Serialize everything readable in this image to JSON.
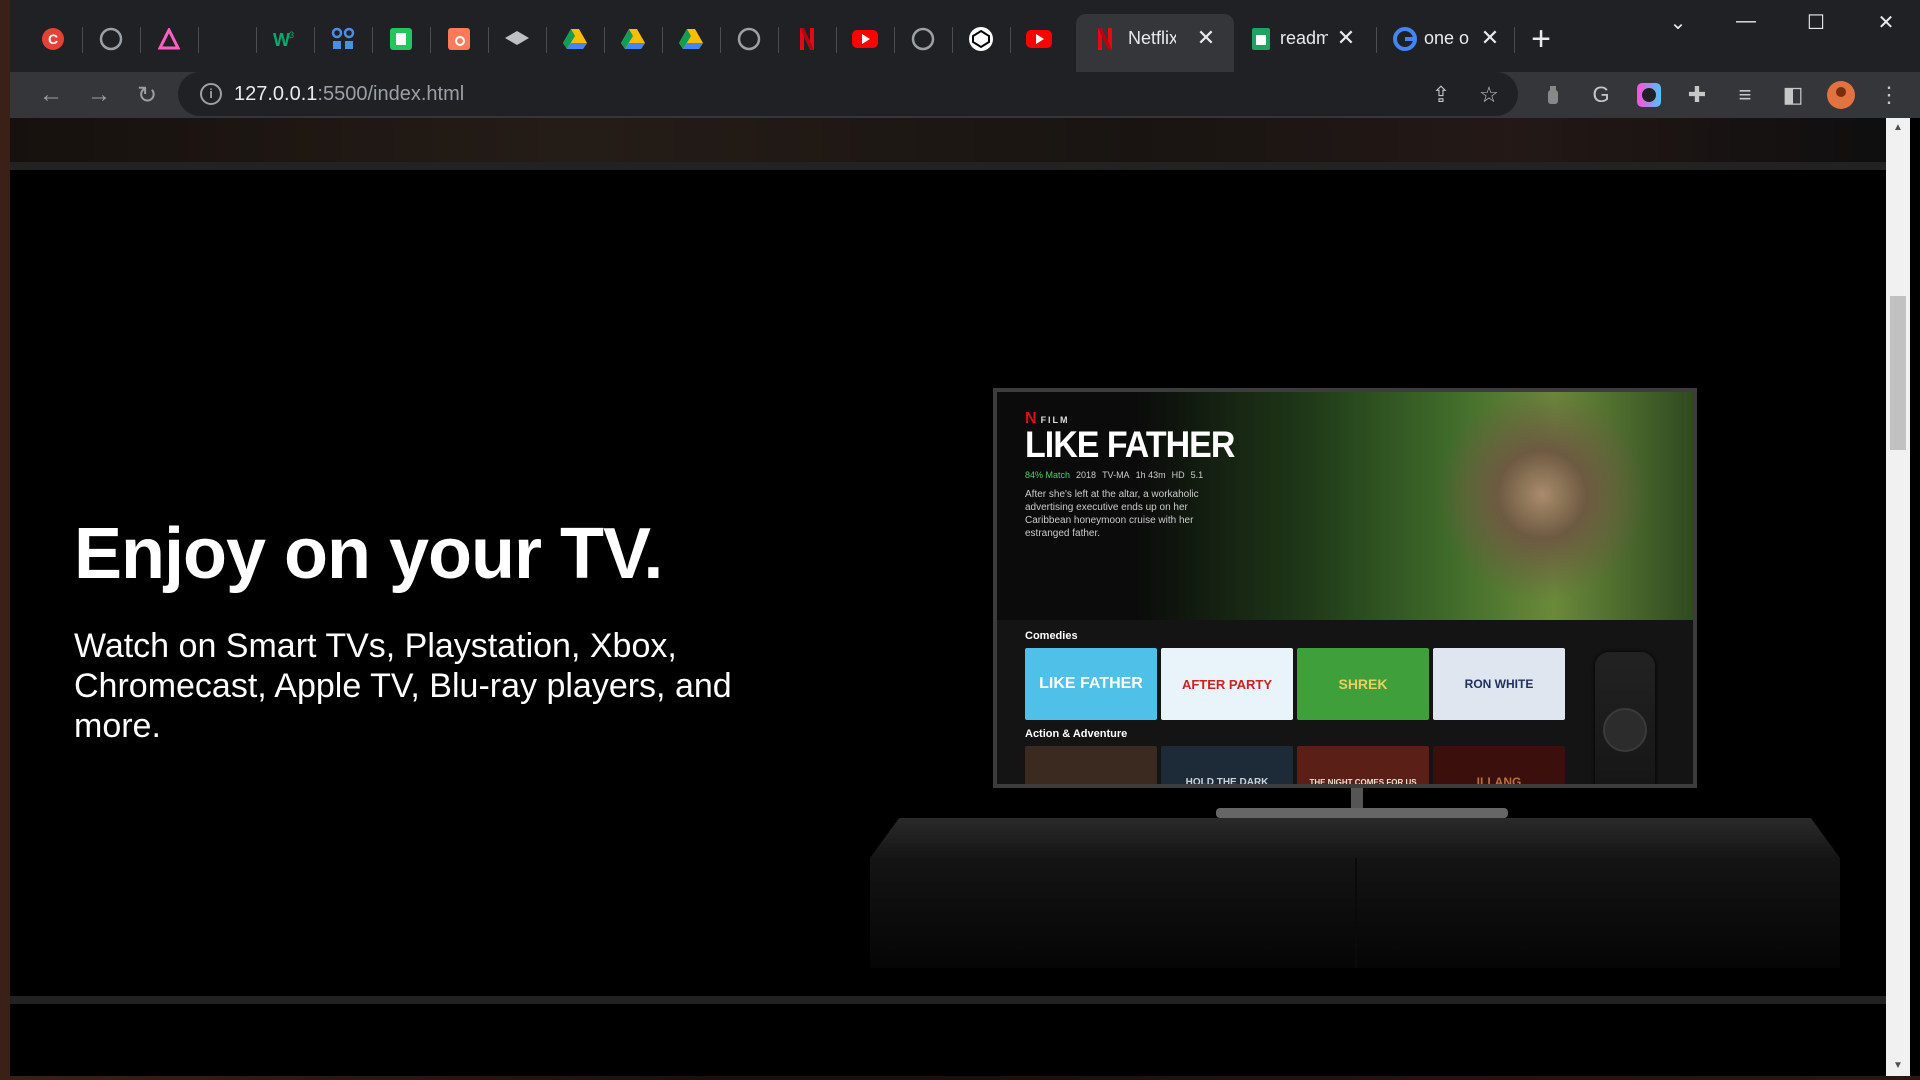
{
  "browser": {
    "tabs": [
      {
        "icon": "c-logo-icon",
        "color": "#e34234"
      },
      {
        "icon": "github-icon",
        "color": "#9aa0a6"
      },
      {
        "icon": "rainbow-a-icon",
        "color": "#ff5ec4"
      },
      {
        "icon": "blank-icon",
        "color": "#202124"
      },
      {
        "icon": "w3-icon",
        "color": "#04aa6d"
      },
      {
        "icon": "grid-icon",
        "color": "#4a90e2"
      },
      {
        "icon": "green-square-icon",
        "color": "#22c55e"
      },
      {
        "icon": "hubspot-icon",
        "color": "#ff7a59"
      },
      {
        "icon": "layers-icon",
        "color": "#bdc1c6"
      },
      {
        "icon": "drive-icon",
        "color": "#fbbc04"
      },
      {
        "icon": "drive-icon",
        "color": "#fbbc04"
      },
      {
        "icon": "drive-icon",
        "color": "#fbbc04"
      },
      {
        "icon": "github-icon",
        "color": "#9aa0a6"
      },
      {
        "icon": "netflix-icon",
        "color": "#e50914"
      },
      {
        "icon": "youtube-icon",
        "color": "#ff0000"
      },
      {
        "icon": "github-icon",
        "color": "#9aa0a6"
      },
      {
        "icon": "codepen-icon",
        "color": "#ffffff"
      },
      {
        "icon": "youtube-icon",
        "color": "#ff0000"
      }
    ],
    "open_tabs": [
      {
        "title": "Netflix",
        "icon": "netflix-icon",
        "active": true
      },
      {
        "title": "readme",
        "icon": "sheets-icon",
        "active": false
      },
      {
        "title": "one o",
        "icon": "google-icon",
        "active": false
      }
    ],
    "url_host": "127.0.0.1",
    "url_path": ":5500/index.html"
  },
  "page": {
    "headline": "Enjoy on your TV.",
    "subline": "Watch on Smart TVs, Playstation, Xbox, Chromecast, Apple TV, Blu-ray players, and more."
  },
  "tv": {
    "badge": "N",
    "badge_label": "FILM",
    "title": "LIKE FATHER",
    "match": "84% Match",
    "year": "2018",
    "rating": "TV-MA",
    "duration": "1h 43m",
    "quality": "HD",
    "audio": "5.1",
    "description": "After she's left at the altar, a workaholic advertising executive ends up on her Caribbean honeymoon cruise with her estranged father.",
    "row1_label": "Comedies",
    "row2_label": "Action & Adventure",
    "row1": [
      "LIKE FATHER",
      "AFTER PARTY",
      "SHREK",
      "RON WHITE"
    ],
    "row2": [
      "",
      "HOLD THE DARK",
      "THE NIGHT COMES FOR US",
      "ILLANG"
    ]
  }
}
